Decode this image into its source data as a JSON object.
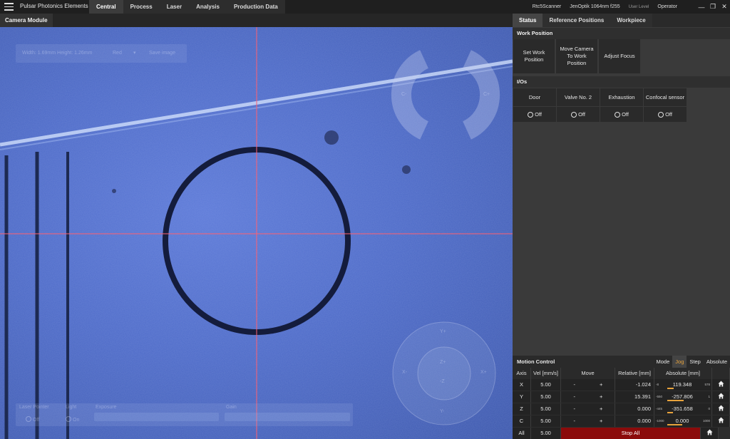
{
  "app": {
    "title": "Pulsar Photonics Elements"
  },
  "nav": {
    "items": [
      "Central",
      "Process",
      "Laser",
      "Analysis",
      "Production Data"
    ],
    "active": "Central"
  },
  "topright": {
    "scanner": "Rtc5Scanner",
    "optics": "JenOptik 1064nm f255",
    "user_level_label": "User Level",
    "user_level": "Operator"
  },
  "camera": {
    "tab": "Camera Module",
    "overlay": {
      "dimensions": "Width: 1.69mm Height: 1.26mm",
      "color": "Red",
      "save_image": "Save image",
      "laser_pointer": "Laser Pointer",
      "laser_pointer_state": "Off",
      "light": "Light",
      "light_state": "On",
      "exposure": "Exposure",
      "gain": "Gain"
    },
    "joystick": {
      "c_minus": "C-",
      "c_plus": "C+",
      "y_plus": "Y+",
      "y_minus": "Y-",
      "x_minus": "X-",
      "x_plus": "X+",
      "z_plus": "Z+",
      "z_minus": "-Z"
    }
  },
  "panel": {
    "tabs": [
      "Status",
      "Reference Positions",
      "Workpiece"
    ],
    "active_tab": "Status",
    "work_position": {
      "title": "Work Position",
      "buttons": [
        "Set Work Position",
        "Move Camera To Work Position",
        "Adjust Focus"
      ]
    },
    "ios": {
      "title": "I/Os",
      "items": [
        {
          "label": "Door",
          "state": "Off"
        },
        {
          "label": "Valve No. 2",
          "state": "Off"
        },
        {
          "label": "Exhaustion",
          "state": "Off"
        },
        {
          "label": "Confocal sensor",
          "state": "Off"
        }
      ]
    }
  },
  "motion": {
    "title": "Motion Control",
    "mode_label": "Mode",
    "modes": [
      "Jog",
      "Step",
      "Absolute"
    ],
    "active_mode": "Jog",
    "headers": {
      "axis": "Axis",
      "vel": "Vel [mm/s]",
      "move": "Move",
      "rel": "Relative [mm]",
      "abs": "Absolute [mm]"
    },
    "axes": [
      {
        "axis": "X",
        "vel": "5.00",
        "minus": "-",
        "plus": "+",
        "rel": "-1.024",
        "min": "-8",
        "abs": "119.348",
        "max": "578",
        "fill": 0.22
      },
      {
        "axis": "Y",
        "vel": "5.00",
        "minus": "-",
        "plus": "+",
        "rel": "15.391",
        "min": "-550",
        "abs": "-257.806",
        "max": "1",
        "fill": 0.55
      },
      {
        "axis": "Z",
        "vel": "5.00",
        "minus": "-",
        "plus": "+",
        "rel": "0.000",
        "min": "-445",
        "abs": "-351.658",
        "max": "0",
        "fill": 0.2
      },
      {
        "axis": "C",
        "vel": "5.00",
        "minus": "-",
        "plus": "+",
        "rel": "0.000",
        "min": "-1000",
        "abs": "0.000",
        "max": "1000",
        "fill": 0.5
      }
    ],
    "all": {
      "axis": "All",
      "vel": "5.00",
      "stop": "Stop All"
    },
    "accent": "#e8a33c"
  }
}
